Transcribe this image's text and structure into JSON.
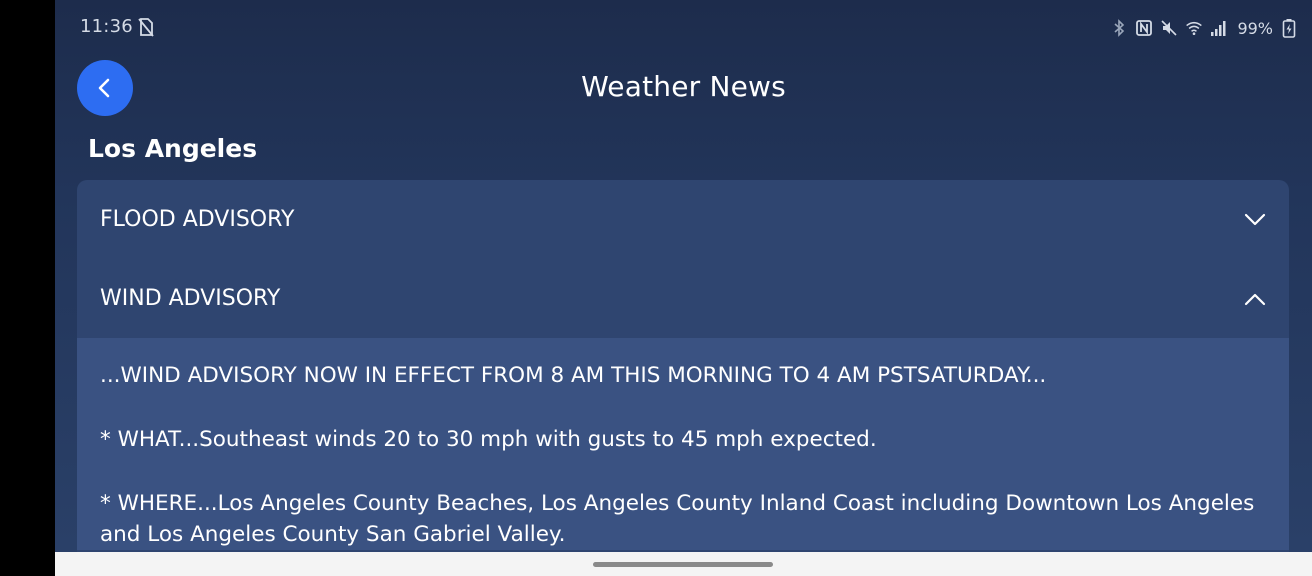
{
  "status_bar": {
    "time": "11:36",
    "battery": "99%",
    "icons": [
      "no-sim-icon",
      "bluetooth-icon",
      "nfc-icon",
      "mute-icon",
      "wifi-icon",
      "signal-icon",
      "battery-charging-icon"
    ]
  },
  "header": {
    "title": "Weather News",
    "back_icon": "chevron-left-icon"
  },
  "location": "Los Angeles",
  "advisories": [
    {
      "title": "FLOOD ADVISORY",
      "expanded": false
    },
    {
      "title": "WIND ADVISORY",
      "expanded": true,
      "paragraphs": [
        "...WIND ADVISORY NOW IN EFFECT FROM 8 AM THIS MORNING TO 4 AM PSTSATURDAY...",
        "* WHAT...Southeast winds 20 to 30 mph with gusts to 45 mph expected.",
        "* WHERE...Los Angeles County Beaches, Los Angeles County Inland Coast including Downtown Los Angeles and Los Angeles County San Gabriel Valley."
      ]
    }
  ],
  "colors": {
    "background": "#22355a",
    "card": "#2f4570",
    "card_expanded": "#3a5282",
    "accent": "#2d6df2"
  }
}
